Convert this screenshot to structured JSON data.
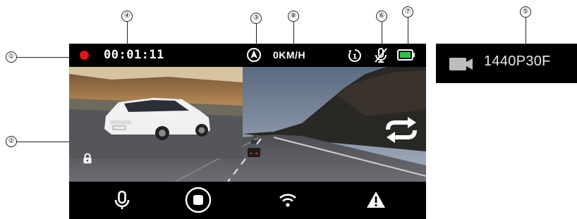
{
  "callouts": {
    "c1": "①",
    "c2": "②",
    "c3": "③",
    "c4": "④",
    "c5": "⑤",
    "c6": "⑥",
    "c7": "⑦",
    "c8": "⑧"
  },
  "status_bar": {
    "recording_indicator_color": "#e0141b",
    "timer": "00:01:11",
    "speed": "0KM/H",
    "icons": [
      "speed-compass-icon",
      "loop-recording-icon",
      "mic-muted-icon",
      "battery-icon"
    ],
    "battery_color": "#2fc34a"
  },
  "views": {
    "front": "road-ahead-view",
    "rear": "rear-car-view",
    "icons": [
      "lock-icon",
      "swap-camera-icon"
    ]
  },
  "toolbar": {
    "buttons": [
      "microphone-icon",
      "stop-record-icon",
      "wifi-icon",
      "warning-icon"
    ]
  },
  "resolution": {
    "icon": "video-camera-icon",
    "label": "1440P30F"
  }
}
